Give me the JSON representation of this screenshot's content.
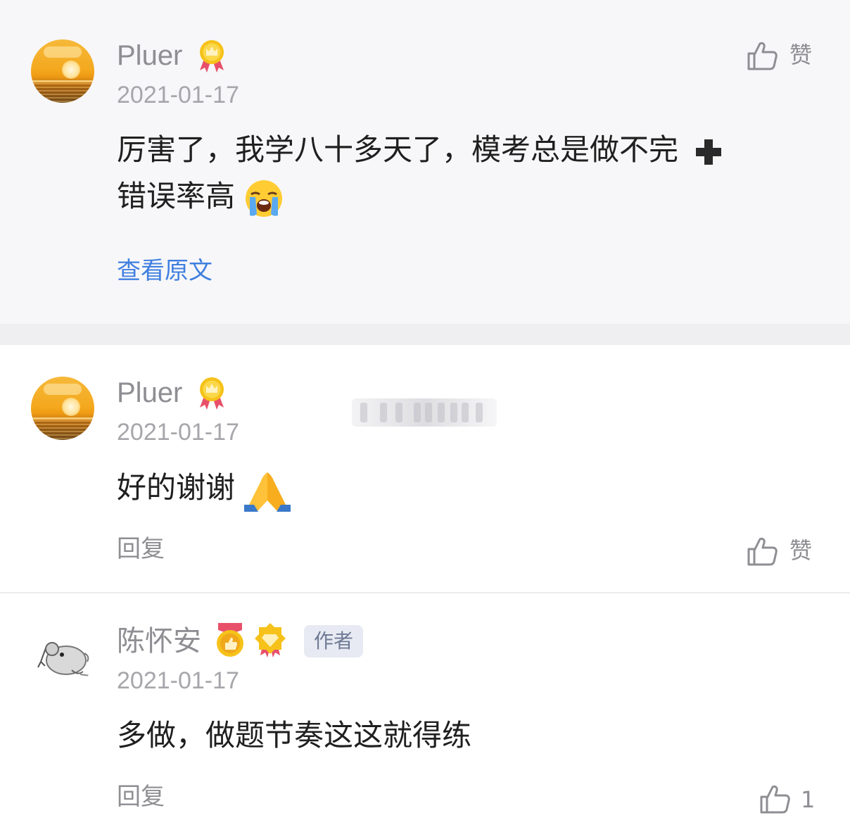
{
  "comments": [
    {
      "username": "Pluer",
      "date": "2021-01-17",
      "text_line1": "厉害了，我学八十多天了，模考总是做不完",
      "text_line2": "错误率高",
      "link": "查看原文",
      "like_label": "赞",
      "avatar": "sunset-avatar",
      "badge": "crown-medal-icon"
    },
    {
      "username": "Pluer",
      "date": "2021-01-17",
      "text": "好的谢谢",
      "reply_label": "回复",
      "like_label": "赞",
      "avatar": "sunset-avatar",
      "badge": "crown-medal-icon"
    },
    {
      "username": "陈怀安",
      "date": "2021-01-17",
      "text": "多做，做题节奏这这就得练",
      "author_tag": "作者",
      "reply_label": "回复",
      "like_count": "1",
      "avatar": "hamster-sketch-avatar",
      "badges": [
        "thumb-medal-icon",
        "diamond-medal-icon"
      ]
    }
  ],
  "colors": {
    "page_bg": "#ffffff",
    "highlight_bg": "#f7f7f9",
    "link_blue": "#3f7fe0",
    "muted_text": "#8e8e93",
    "badge_gold": "#f6c21a",
    "ribbon_red": "#e8506a"
  }
}
